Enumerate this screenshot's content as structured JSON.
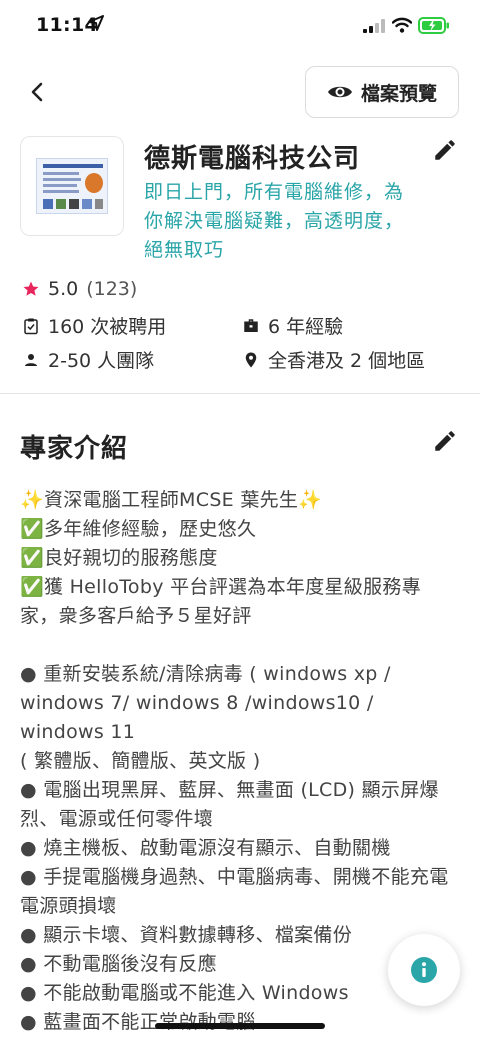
{
  "status_bar": {
    "time": "11:14"
  },
  "nav": {
    "preview_label": "檔案預覽"
  },
  "profile": {
    "company_name": "德斯電腦科技公司",
    "tagline": "即日上門，所有電腦維修，為你解決電腦疑難，高透明度，絕無取巧",
    "rating": "5.0",
    "rating_count": "(123)",
    "hired": "160 次被聘用",
    "experience": "6 年經驗",
    "team": "2-50 人團隊",
    "area": "全香港及 2 個地區"
  },
  "intro": {
    "title": "專家介紹",
    "lines": [
      "✨資深電腦工程師MCSE  葉先生✨",
      "✅多年維修經驗，歷史悠久",
      "✅良好親切的服務態度",
      "✅獲 HelloToby 平台評選為本年度星級服務專家，衆多客戶給予５星好評",
      "",
      "● 重新安裝系統/清除病毒 ( windows xp / windows 7/ windows 8 /windows10 / windows 11",
      "( 繁體版、簡體版、英文版 )",
      "● 電腦出現黑屏、藍屏、無畫面 (LCD) 顯示屏爆烈、電源或任何零件壞",
      "● 燒主機板、啟動電源沒有顯示、自動關機",
      "● 手提電腦機身過熱、中電腦病毒、開機不能充電電源頭損壞",
      "● 顯示卡壞、資料數據轉移、檔案備份",
      "● 不動電腦後沒有反應",
      "● 不能啟動電腦或不能進入 Windows",
      "● 藍畫面不能正常啟動電腦"
    ]
  },
  "colors": {
    "accent": "#2aa5a8",
    "star": "#e8265e",
    "battery": "#2ecc40"
  },
  "icons": [
    "location-arrow-icon",
    "signal-icon",
    "wifi-icon",
    "battery-icon",
    "back-arrow-icon",
    "eye-icon",
    "pencil-icon",
    "star-icon",
    "clipboard-check-icon",
    "briefcase-icon",
    "person-icon",
    "location-pin-icon",
    "info-icon"
  ]
}
